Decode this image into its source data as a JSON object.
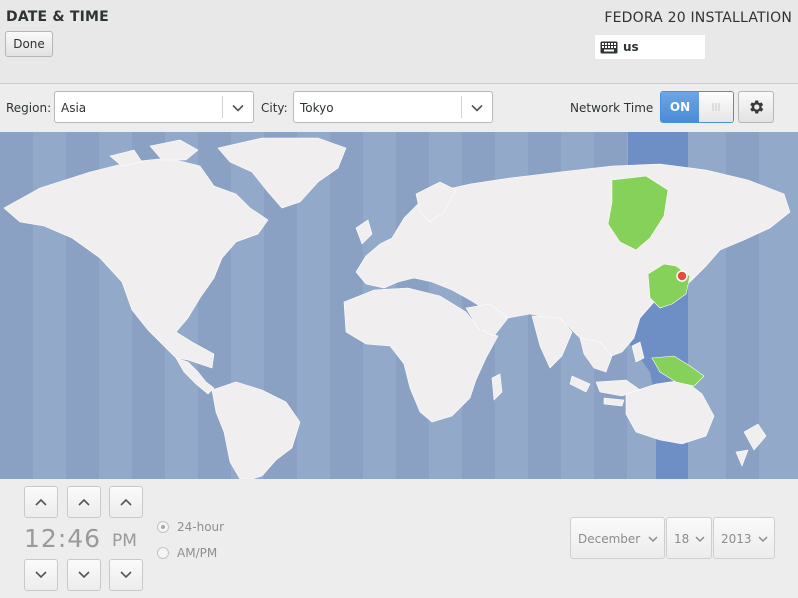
{
  "header": {
    "page_title": "DATE & TIME",
    "done_label": "Done",
    "product_title": "FEDORA 20 INSTALLATION",
    "keyboard_layout": "us",
    "keyboard_icon": "keyboard-icon"
  },
  "toolbar": {
    "region_label": "Region:",
    "region_value": "Asia",
    "city_label": "City:",
    "city_value": "Tokyo",
    "network_time_label": "Network Time",
    "network_time_state": "ON",
    "settings_icon": "gear-icon"
  },
  "map": {
    "selected_zone_color": "#86d159",
    "timezone_band_color": "#6e8fc6",
    "ocean_color": "#93a9c9",
    "land_color": "#f0eeee",
    "marker_color": "#e74c3c"
  },
  "time": {
    "hours": "12",
    "separator": ":",
    "minutes": "46",
    "period": "PM",
    "format_24h_label": "24-hour",
    "format_ampm_label": "AM/PM"
  },
  "date": {
    "month": "December",
    "day": "18",
    "year": "2013"
  }
}
